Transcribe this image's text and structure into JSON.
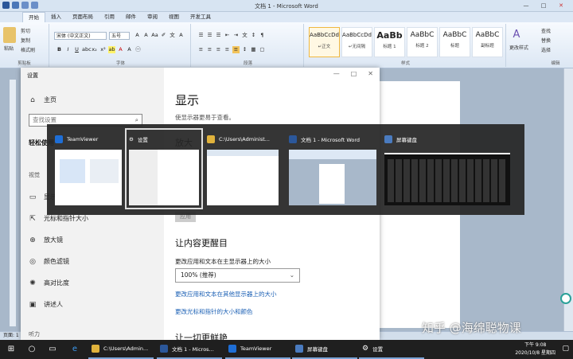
{
  "word": {
    "title": "文档 1 - Microsoft Word",
    "tabs": [
      "开始",
      "插入",
      "页面布局",
      "引用",
      "邮件",
      "审阅",
      "视图",
      "开发工具"
    ],
    "clipboard": {
      "paste": "粘贴",
      "cut": "剪切",
      "copy": "复制",
      "format_painter": "格式刷",
      "label": "剪贴板"
    },
    "font": {
      "name": "宋体 (中文正文)",
      "size": "五号",
      "label": "字体"
    },
    "paragraph_label": "段落",
    "styles": [
      {
        "preview": "AaBbCcDd",
        "name": "↵正文"
      },
      {
        "preview": "AaBbCcDd",
        "name": "↵无间隔"
      },
      {
        "preview": "AaBb",
        "name": "标题 1"
      },
      {
        "preview": "AaBbC",
        "name": "标题 2"
      },
      {
        "preview": "AaBbC",
        "name": "标题"
      },
      {
        "preview": "AaBbC",
        "name": "副标题"
      }
    ],
    "change_styles": "更改样式",
    "styles_label": "样式",
    "editing": {
      "find": "查找",
      "replace": "替换",
      "select": "选择",
      "label": "编辑"
    },
    "status": "页面: 1"
  },
  "settings": {
    "app_title": "设置",
    "home": "主页",
    "search_placeholder": "查找设置",
    "section": "轻松使用",
    "subsection": "视觉",
    "nav_items": [
      "显示",
      "光标和指针大小",
      "放大镜",
      "颜色滤镜",
      "高对比度",
      "讲述人"
    ],
    "bottom_label": "听力",
    "page_title": "显示",
    "page_subtitle": "使显示器更易于查看。",
    "enlarge_heading": "放大",
    "apply_button": "应用",
    "make_bigger_heading": "让内容更醒目",
    "scale_label": "更改应用和文本在主显示器上的大小",
    "scale_value": "100% (推荐)",
    "link1": "更改应用和文本在其他显示器上的大小",
    "link2": "更改光标和指针的大小和颜色",
    "next_heading": "让一切更鲜艳"
  },
  "switcher": {
    "items": [
      {
        "label": "TeamViewer",
        "color": "#1e6ed6"
      },
      {
        "label": "设置",
        "color": "#555555",
        "selected": true
      },
      {
        "label": "C:\\Users\\Administ...",
        "color": "#e0b23c"
      },
      {
        "label": "文档 1 - Microsoft Word",
        "color": "#2b579a"
      },
      {
        "label": "屏幕键盘",
        "color": "#4a7bbf"
      }
    ]
  },
  "taskbar": {
    "apps": [
      {
        "label": "C:\\Users\\Admin...",
        "icon": "folder-icon",
        "color": "#e0b23c"
      },
      {
        "label": "文档 1 - Micros...",
        "icon": "word-icon",
        "color": "#2b579a"
      },
      {
        "label": "TeamViewer",
        "icon": "teamviewer-icon",
        "color": "#1e6ed6"
      },
      {
        "label": "屏幕键盘",
        "icon": "keyboard-icon",
        "color": "#4a7bbf"
      },
      {
        "label": "设置",
        "icon": "gear-icon",
        "color": "#555555"
      }
    ],
    "time": "下午 9:08",
    "date": "2020/10/8 星期四"
  },
  "watermark": "知乎 @海绵聪物课"
}
